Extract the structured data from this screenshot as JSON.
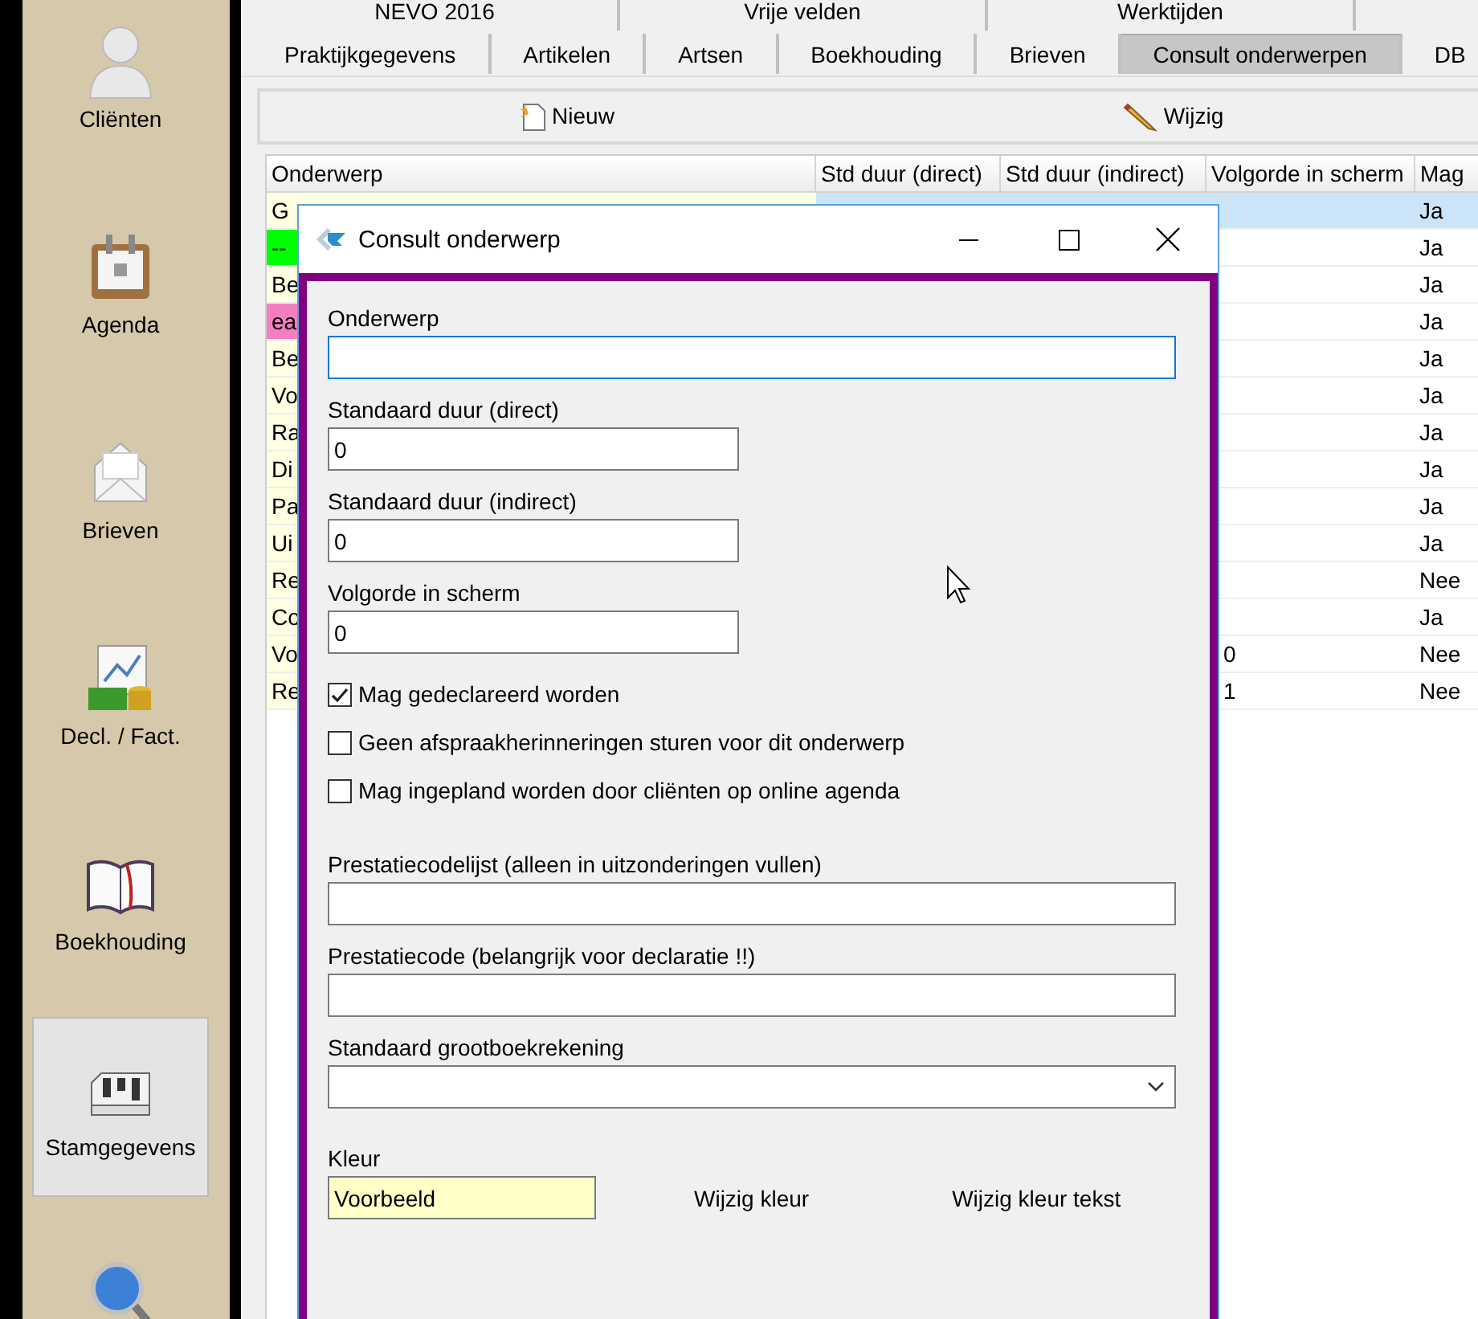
{
  "sidebar": {
    "items": [
      {
        "kind": "person",
        "label": "Cliënten",
        "selected": false
      },
      {
        "kind": "calendar",
        "label": "Agenda",
        "selected": false
      },
      {
        "kind": "envelope",
        "label": "Brieven",
        "selected": false
      },
      {
        "kind": "finance",
        "label": "Decl. / Fact.",
        "selected": false
      },
      {
        "kind": "book",
        "label": "Boekhouding",
        "selected": false
      },
      {
        "kind": "mixer",
        "label": "Stamgegevens",
        "selected": true
      },
      {
        "kind": "magnifier",
        "selected": false
      }
    ]
  },
  "upper_tabs": [
    {
      "label": "NEVO 2016",
      "selected": false
    },
    {
      "label": "Vrije velden",
      "selected": false
    },
    {
      "label": "Werktijden",
      "selected": false
    }
  ],
  "lower_tabs": [
    {
      "label": "Praktijkgegevens",
      "selected": false
    },
    {
      "label": "Artikelen",
      "selected": false
    },
    {
      "label": "Artsen",
      "selected": false
    },
    {
      "label": "Boekhouding",
      "selected": false
    },
    {
      "label": "Brieven",
      "selected": false
    },
    {
      "label": "Consult onderwerpen",
      "selected": true
    },
    {
      "label": "DB",
      "selected": false
    }
  ],
  "toolbar": {
    "buttons": [
      {
        "kind": "new",
        "label": "Nieuw"
      },
      {
        "kind": "edit",
        "label": "Wijzig"
      }
    ]
  },
  "table": {
    "columns": [
      "Onderwerp",
      "Std duur (direct)",
      "Std duur (indirect)",
      "Volgorde in scherm",
      "Mag"
    ],
    "rows": [
      {
        "onderwerp": "G",
        "mag": "Ja",
        "color": "#ffffe1",
        "selected": true
      },
      {
        "onderwerp": "--",
        "mag": "Ja",
        "color": "#00ff00",
        "selected": false
      },
      {
        "onderwerp": "Be",
        "mag": "Ja",
        "color": "#ffffe1",
        "selected": false
      },
      {
        "onderwerp": "ea",
        "mag": "Ja",
        "color": "#f47fc0",
        "selected": false
      },
      {
        "onderwerp": "Be",
        "mag": "Ja",
        "color": "#ffffe1",
        "selected": false
      },
      {
        "onderwerp": "Vo",
        "mag": "Ja",
        "color": "#ffffe1",
        "selected": false
      },
      {
        "onderwerp": "Ra",
        "mag": "Ja",
        "color": "#ffffe1",
        "selected": false
      },
      {
        "onderwerp": "Di",
        "mag": "Ja",
        "color": "#ffffe1",
        "selected": false
      },
      {
        "onderwerp": "Pa",
        "mag": "Ja",
        "color": "#ffffe1",
        "selected": false
      },
      {
        "onderwerp": "Ui",
        "mag": "Ja",
        "color": "#ffffe1",
        "selected": false
      },
      {
        "onderwerp": "Re",
        "mag": "Nee",
        "color": "#ffffe1",
        "selected": false
      },
      {
        "onderwerp": "Co",
        "mag": "Ja",
        "color": "#ffffe1",
        "selected": false
      },
      {
        "onderwerp": "Vo",
        "volgorde": "0",
        "mag": "Nee",
        "color": "#ffffe1",
        "selected": false
      },
      {
        "onderwerp": "Re",
        "volgorde": "1",
        "mag": "Nee",
        "color": "#ffffe1",
        "selected": false
      }
    ]
  },
  "dialog": {
    "title": "Consult onderwerp",
    "fields": [
      {
        "kind": "text",
        "label": "Onderwerp",
        "focused": true
      },
      {
        "kind": "number",
        "label": "Standaard duur (direct)",
        "value": "0",
        "focused": false
      },
      {
        "kind": "number",
        "label": "Standaard duur (indirect)",
        "value": "0",
        "focused": false
      },
      {
        "kind": "number",
        "label": "Volgorde in scherm",
        "value": "0",
        "focused": false
      },
      {
        "kind": "checkbox",
        "label": "Mag gedeclareerd worden",
        "checked": true
      },
      {
        "kind": "checkbox",
        "label": "Geen afspraakherinneringen sturen voor dit onderwerp",
        "checked": false
      },
      {
        "kind": "checkbox",
        "label": "Mag ingepland worden door cliënten op online agenda",
        "checked": false
      },
      {
        "kind": "text",
        "label": "Prestatiecodelijst (alleen in uitzonderingen vullen)",
        "focused": false
      },
      {
        "kind": "text",
        "label": "Prestatiecode (belangrijk voor declaratie !!)",
        "focused": false
      },
      {
        "kind": "select",
        "label": "Standaard grootboekrekening"
      },
      {
        "kind": "color",
        "label": "Kleur",
        "value": "Voorbeeld",
        "color": "#ffffc8",
        "buttons": [
          "Wijzig kleur",
          "Wijzig kleur tekst"
        ]
      }
    ]
  }
}
